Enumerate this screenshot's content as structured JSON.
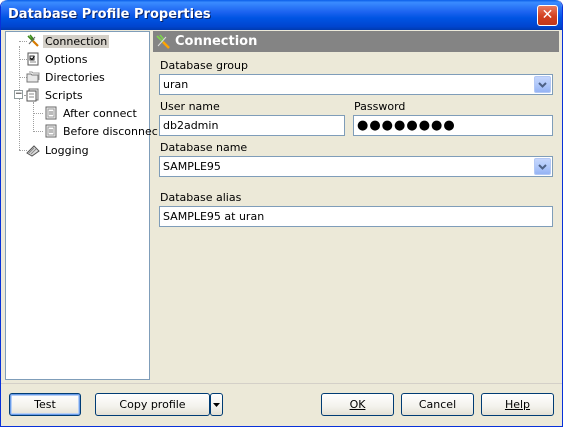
{
  "window": {
    "title": "Database Profile Properties",
    "close_label": "✕"
  },
  "tree": {
    "items": [
      {
        "label": "Connection",
        "icon": "connection-icon",
        "selected": true
      },
      {
        "label": "Options",
        "icon": "options-icon"
      },
      {
        "label": "Directories",
        "icon": "folders-icon"
      },
      {
        "label": "Scripts",
        "icon": "scripts-icon",
        "expanded": true,
        "expander": "−"
      },
      {
        "label": "After connect",
        "icon": "script-doc-icon"
      },
      {
        "label": "Before disconnec",
        "icon": "script-doc-icon"
      },
      {
        "label": "Logging",
        "icon": "logging-icon"
      }
    ]
  },
  "panel": {
    "header": "Connection",
    "database_group_label": "Database group",
    "database_group_value": "uran",
    "user_name_label": "User name",
    "user_name_value": "db2admin",
    "password_label": "Password",
    "password_value": "●●●●●●●●",
    "database_name_label": "Database name",
    "database_name_value": "SAMPLE95",
    "database_alias_label": "Database alias",
    "database_alias_value": "SAMPLE95 at uran"
  },
  "buttons": {
    "test": "Test",
    "copy_profile": "Copy profile",
    "ok": "OK",
    "cancel": "Cancel",
    "help": "Help"
  },
  "colors": {
    "titlebar": "#0054e3",
    "dialog_bg": "#ece9d8",
    "panel_header": "#848484",
    "input_border": "#7f9db9"
  }
}
